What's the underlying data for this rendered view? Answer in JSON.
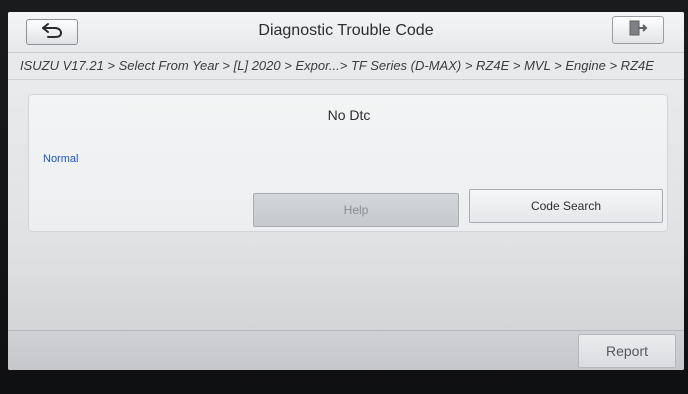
{
  "header": {
    "title": "Diagnostic Trouble Code",
    "back_icon": "back-arrow-icon",
    "exit_icon": "exit-door-icon"
  },
  "breadcrumb": {
    "path": "ISUZU V17.21 > Select From Year > [L] 2020 > Expor...> TF Series (D-MAX) > RZ4E > MVL > Engine > RZ4E"
  },
  "dtc_panel": {
    "title": "No Dtc",
    "status": "Normal",
    "help_label": "Help",
    "code_search_label": "Code Search"
  },
  "footer": {
    "report_label": "Report"
  },
  "colors": {
    "status_text": "#1a55c8",
    "screen_bg": "#e6e8ea",
    "disabled_button": "#c9ccd0"
  }
}
